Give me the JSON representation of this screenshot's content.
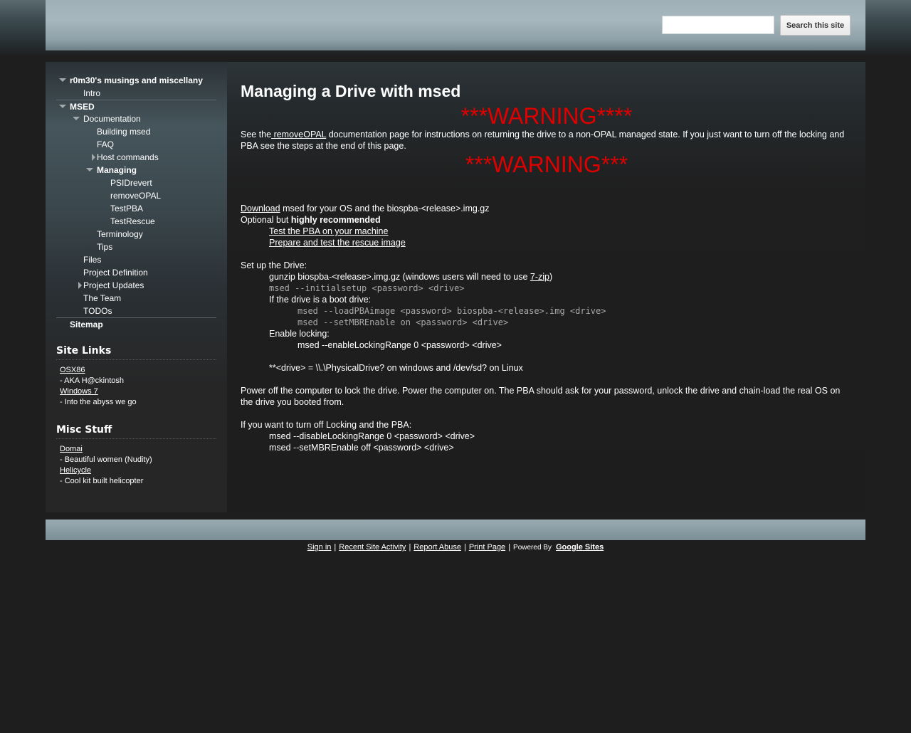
{
  "header": {
    "search_placeholder": "",
    "search_button": "Search this site"
  },
  "nav": [
    {
      "label": "r0m30's musings and miscellany",
      "level": 0,
      "bold": true,
      "toggle": "down"
    },
    {
      "label": "Intro",
      "level": 1,
      "bold": false,
      "toggle": ""
    },
    {
      "label": "MSED",
      "level": 0,
      "bold": true,
      "toggle": "down",
      "sep": true
    },
    {
      "label": "Documentation",
      "level": 1,
      "bold": false,
      "toggle": "down"
    },
    {
      "label": "Building msed",
      "level": 2,
      "bold": false,
      "toggle": ""
    },
    {
      "label": "FAQ",
      "level": 2,
      "bold": false,
      "toggle": ""
    },
    {
      "label": "Host commands",
      "level": 2,
      "bold": false,
      "toggle": "right"
    },
    {
      "label": "Managing",
      "level": 2,
      "bold": true,
      "toggle": "down"
    },
    {
      "label": "PSIDrevert",
      "level": 3,
      "bold": false,
      "toggle": ""
    },
    {
      "label": "removeOPAL",
      "level": 3,
      "bold": false,
      "toggle": ""
    },
    {
      "label": "TestPBA",
      "level": 3,
      "bold": false,
      "toggle": ""
    },
    {
      "label": "TestRescue",
      "level": 3,
      "bold": false,
      "toggle": ""
    },
    {
      "label": "Terminology",
      "level": 2,
      "bold": false,
      "toggle": ""
    },
    {
      "label": "Tips",
      "level": 2,
      "bold": false,
      "toggle": ""
    },
    {
      "label": "Files",
      "level": 1,
      "bold": false,
      "toggle": ""
    },
    {
      "label": "Project Definition",
      "level": 1,
      "bold": false,
      "toggle": ""
    },
    {
      "label": "Project Updates",
      "level": 1,
      "bold": false,
      "toggle": "right"
    },
    {
      "label": "The Team",
      "level": 1,
      "bold": false,
      "toggle": ""
    },
    {
      "label": "TODOs",
      "level": 1,
      "bold": false,
      "toggle": ""
    },
    {
      "label": "Sitemap",
      "level": 0,
      "bold": true,
      "toggle": "",
      "sep": true
    }
  ],
  "site_links": {
    "title": "Site Links",
    "items": [
      {
        "link": "OSX86",
        "desc": "- AKA H@ckintosh"
      },
      {
        "link": "Windows 7",
        "desc": "- Into the abyss we go"
      }
    ]
  },
  "misc_stuff": {
    "title": "Misc Stuff",
    "items": [
      {
        "link": "Domai",
        "desc": "- Beautiful women (Nudity)"
      },
      {
        "link": "Helicycle",
        "desc": "- Cool kit built helicopter"
      }
    ]
  },
  "content": {
    "title": "Managing a Drive with msed",
    "warning1": "***WARNING****",
    "see_pre": "See the",
    "see_link": " removeOPAL",
    "see_post": " documentation page for instructions on returning the drive to a non-OPAL managed state.  If you just want to turn off the locking and PBA see the steps at the end of this page.",
    "warning2": "***WARNING***",
    "download_link": "Download",
    "download_post": " msed for your OS and the biospba-<release>.img.gz",
    "optional_pre": "Optional but ",
    "optional_bold": "highly recommended",
    "test_pba_link": "Test the PBA on your machine",
    "prepare_link": "Prepare and test the rescue image",
    "setup": "Set up the Drive:",
    "gunzip_pre": "gunzip biospba-<release>.img.gz  (windows users will need to use ",
    "sevenzip_link": "7-zip",
    "gunzip_post": ")",
    "cmd_initial": "msed --initialsetup <password> <drive>",
    "boot_drive": "If the drive is a boot drive:",
    "cmd_loadpba": "msed --loadPBAimage <password> biospba-<release>.img  <drive>",
    "cmd_mbr_on": "msed --setMBREnable on <password> <drive>",
    "enable_locking": "Enable locking:",
    "cmd_enable_locking": "msed --enableLockingRange 0 <password> <drive>",
    "drive_note": "**<drive> = \\\\.\\PhysicalDrive? on windows and /dev/sd? on Linux",
    "power_off": "Power off the computer to lock the drive.  Power the computer on. The PBA should ask for your password, unlock the drive and chain-load the real OS on the drive you booted from.",
    "turn_off": "If you want to turn off Locking and the PBA:",
    "cmd_disable": "msed --disableLockingRange 0 <password> <drive>",
    "cmd_mbr_off": "msed --setMBREnable off <password> <drive>"
  },
  "footer": {
    "sign_in": "Sign in",
    "recent": "Recent Site Activity",
    "report": "Report Abuse",
    "print": "Print Page",
    "powered": "Powered By",
    "google_sites": "Google Sites"
  }
}
